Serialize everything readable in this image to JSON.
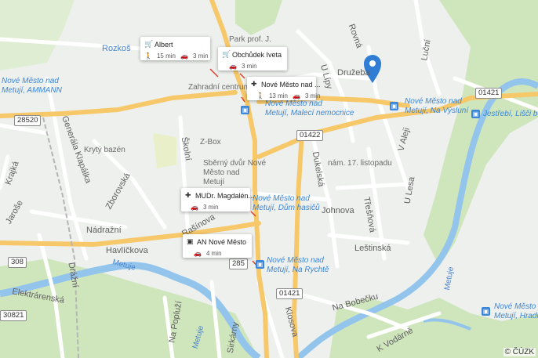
{
  "colors": {
    "water": "#93c4ec",
    "major_road": "#f6c86a",
    "minor_road": "#ffffff",
    "green": "#cfe6bd",
    "stop": "#3b86d8",
    "pin": "#2f7dd4"
  },
  "streets": {
    "rozkos": "Rozkoš",
    "park": "Park prof. J.",
    "druzeba": "Družeba",
    "rovna": "Rovná",
    "lucni": "Luční",
    "u_lipy": "U Lípy",
    "generala": "Generála Klapálka",
    "kryty_bazen": "Krytý bazén",
    "skolni": "Školní",
    "sberny": "Sběrný dvůr Nové\nMěsto nad\nMetují",
    "zborovska": "Zborovská",
    "nadrazni": "Nádražní",
    "havlickova": "Havlíčkova",
    "drazni": "Drážní",
    "elektrarenska": "Elektrárenská",
    "dukelska": "Dukelská",
    "nam17": "nám. 17. listopadu",
    "johnova": "Johnova",
    "tresnova": "Třešňová",
    "leso": "U Lesa",
    "aleji": "V Aleji",
    "lestinska": "Leštinská",
    "na_bobecku": "Na Bobečku",
    "k_vodarne": "K Vodárně",
    "klosova": "Klosova",
    "sirkarny": "Sirkárny",
    "na_poplusi": "Na Popluží",
    "metuje1": "Metuje",
    "metuje2": "Metuje",
    "metuje3": "Metuje",
    "krajka": "Krajká",
    "jarose": "Jaroše",
    "zahradni": "Zahradní centrum",
    "zbox": "Z-Box",
    "rasinova": "Rašínova"
  },
  "stops": {
    "amman": "Nové Město nad\nMetují, AMMANN",
    "vysluni": "Nové Město nad\nMetují, Na Výsluní",
    "malecni": "Nové Město nad\nMetují, Malecí nemocnice",
    "jestrebi": "Jestřebí, Lišči bouda",
    "dum_hasicu": "Nové Město nad\nMetují, Dům hasičů",
    "na_rychte": "Nové Město nad\nMetují, Na Rychtě",
    "hradiste": "Nové Město nad\nMetují, Hradiště"
  },
  "roads": {
    "r1": "28520",
    "r2": "01422",
    "r3": "01421",
    "r4": "01421",
    "r5": "308",
    "r6": "285",
    "r7": "30821"
  },
  "cards": [
    {
      "title": "Albert",
      "walk": "15 min",
      "car": "3 min"
    },
    {
      "title": "Obchůdek Iveta",
      "walk": "",
      "car": "3 min"
    },
    {
      "title": "Nové Město nad ...",
      "walk": "13 min",
      "car": "3 min"
    },
    {
      "title": "MUDr. Magdalén...",
      "walk": "",
      "car": "3 min"
    },
    {
      "title": "AN Nové Město",
      "walk": "",
      "car": "4 min"
    }
  ],
  "icons": {
    "shop": "cart-icon",
    "hospital": "hospital-icon",
    "walk": "walk-icon",
    "car": "car-icon",
    "bus": "bus-icon"
  },
  "copyright": "© ČÚZK"
}
